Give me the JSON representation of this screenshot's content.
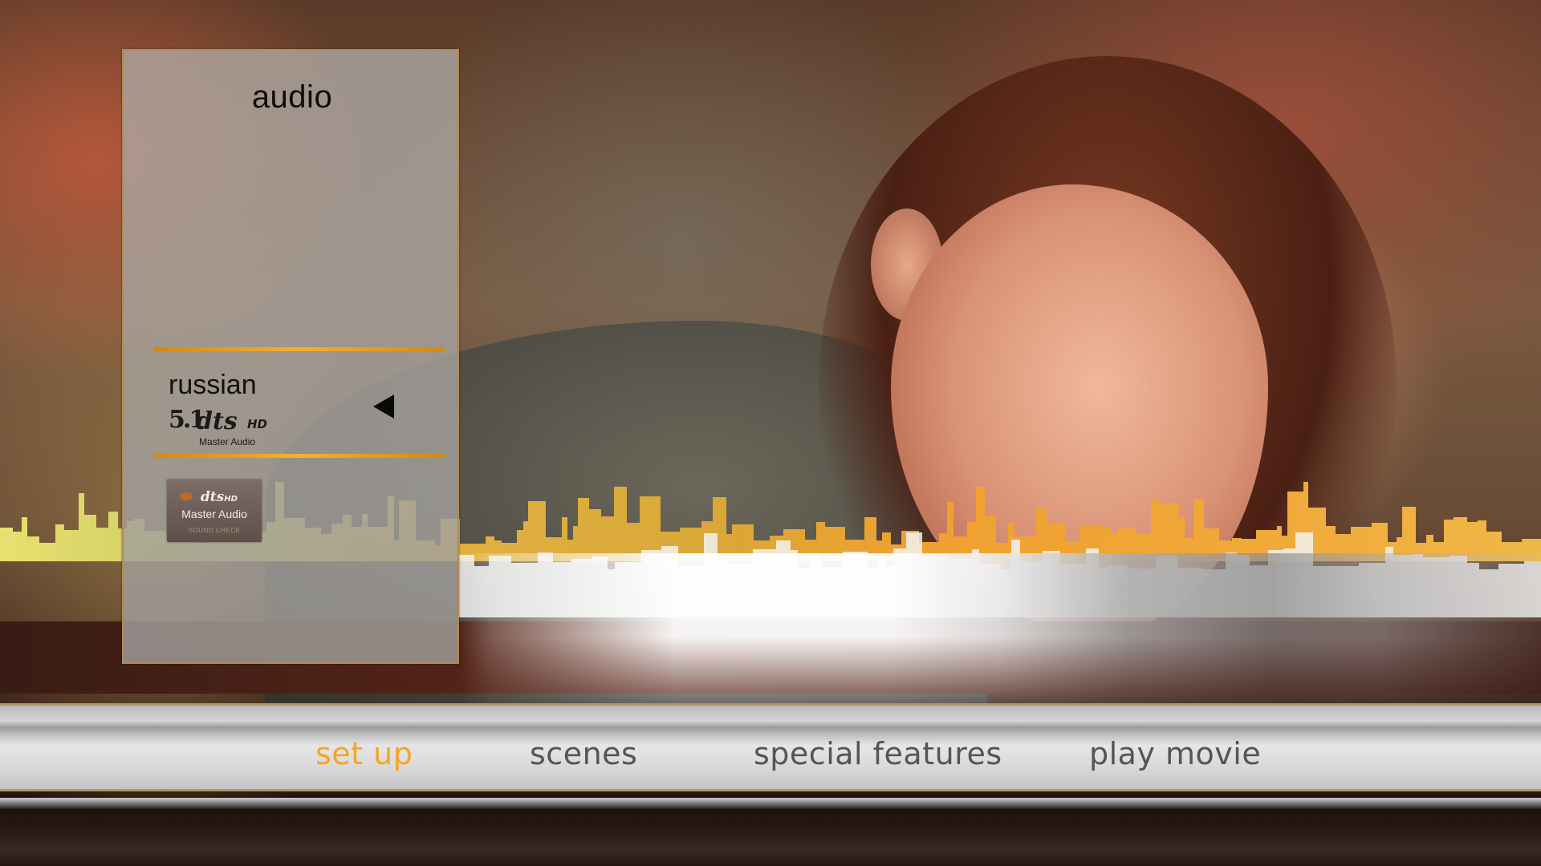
{
  "audio_panel": {
    "title": "audio",
    "selected_track": {
      "language": "russian",
      "format_channels": "5.1",
      "format_logo": "dts",
      "format_logo_suffix": "HD",
      "format_caption": "Master Audio"
    },
    "sound_check_button": {
      "logo": "dts",
      "logo_suffix": "HD",
      "title": "Master Audio",
      "caption": "SOUND CHECK"
    },
    "selector_icon": "left-triangle-icon"
  },
  "nav": {
    "items": [
      {
        "label": "set up",
        "active": true
      },
      {
        "label": "scenes",
        "active": false
      },
      {
        "label": "special features",
        "active": false
      },
      {
        "label": "play movie",
        "active": false
      }
    ]
  },
  "colors": {
    "accent": "#f5a524",
    "selection_line": "#f3b22a",
    "panel_border": "#b08a50",
    "nav_text": "#555555"
  }
}
